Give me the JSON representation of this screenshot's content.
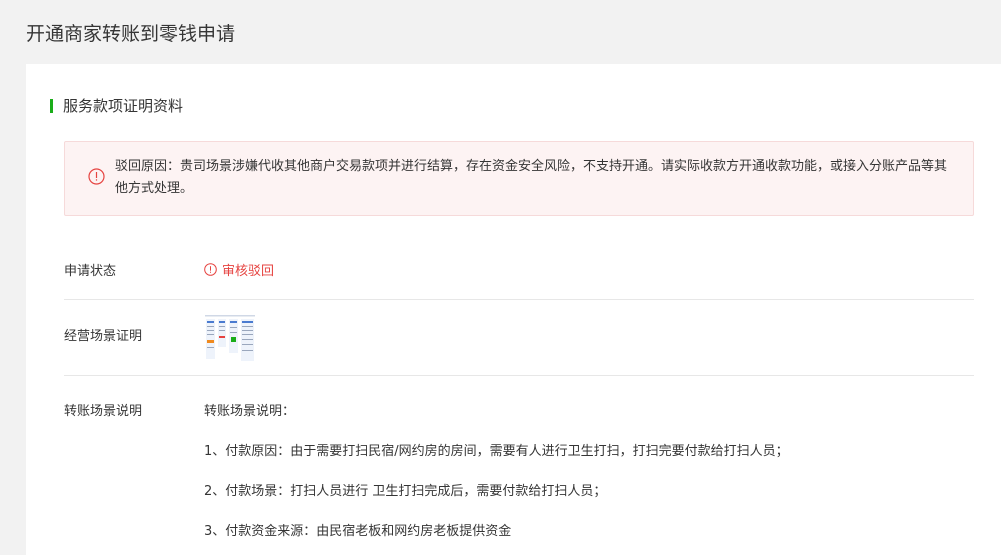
{
  "page": {
    "title": "开通商家转账到零钱申请"
  },
  "section": {
    "title": "服务款项证明资料"
  },
  "alert": {
    "icon": "error-circle-icon",
    "text": "驳回原因：贵司场景涉嫌代收其他商户交易款项并进行结算，存在资金安全风险，不支持开通。请实际收款方开通收款功能，或接入分账产品等其他方式处理。"
  },
  "rows": {
    "status": {
      "label": "申请状态",
      "value": "审核驳回",
      "icon": "warning-circle-icon"
    },
    "scene_proof": {
      "label": "经营场景证明"
    },
    "transfer_desc": {
      "label": "转账场景说明",
      "lines": [
        "转账场景说明：",
        "1、付款原因：由于需要打扫民宿/网约房的房间，需要有人进行卫生打扫，打扫完要付款给打扫人员；",
        "2、付款场景：打扫人员进行 卫生打扫完成后，需要付款给打扫人员；",
        "3、付款资金来源：由民宿老板和网约房老板提供资金"
      ]
    }
  },
  "colors": {
    "accent": "#1aad19",
    "error": "#e64340",
    "alert_bg": "#fdf3f3"
  }
}
